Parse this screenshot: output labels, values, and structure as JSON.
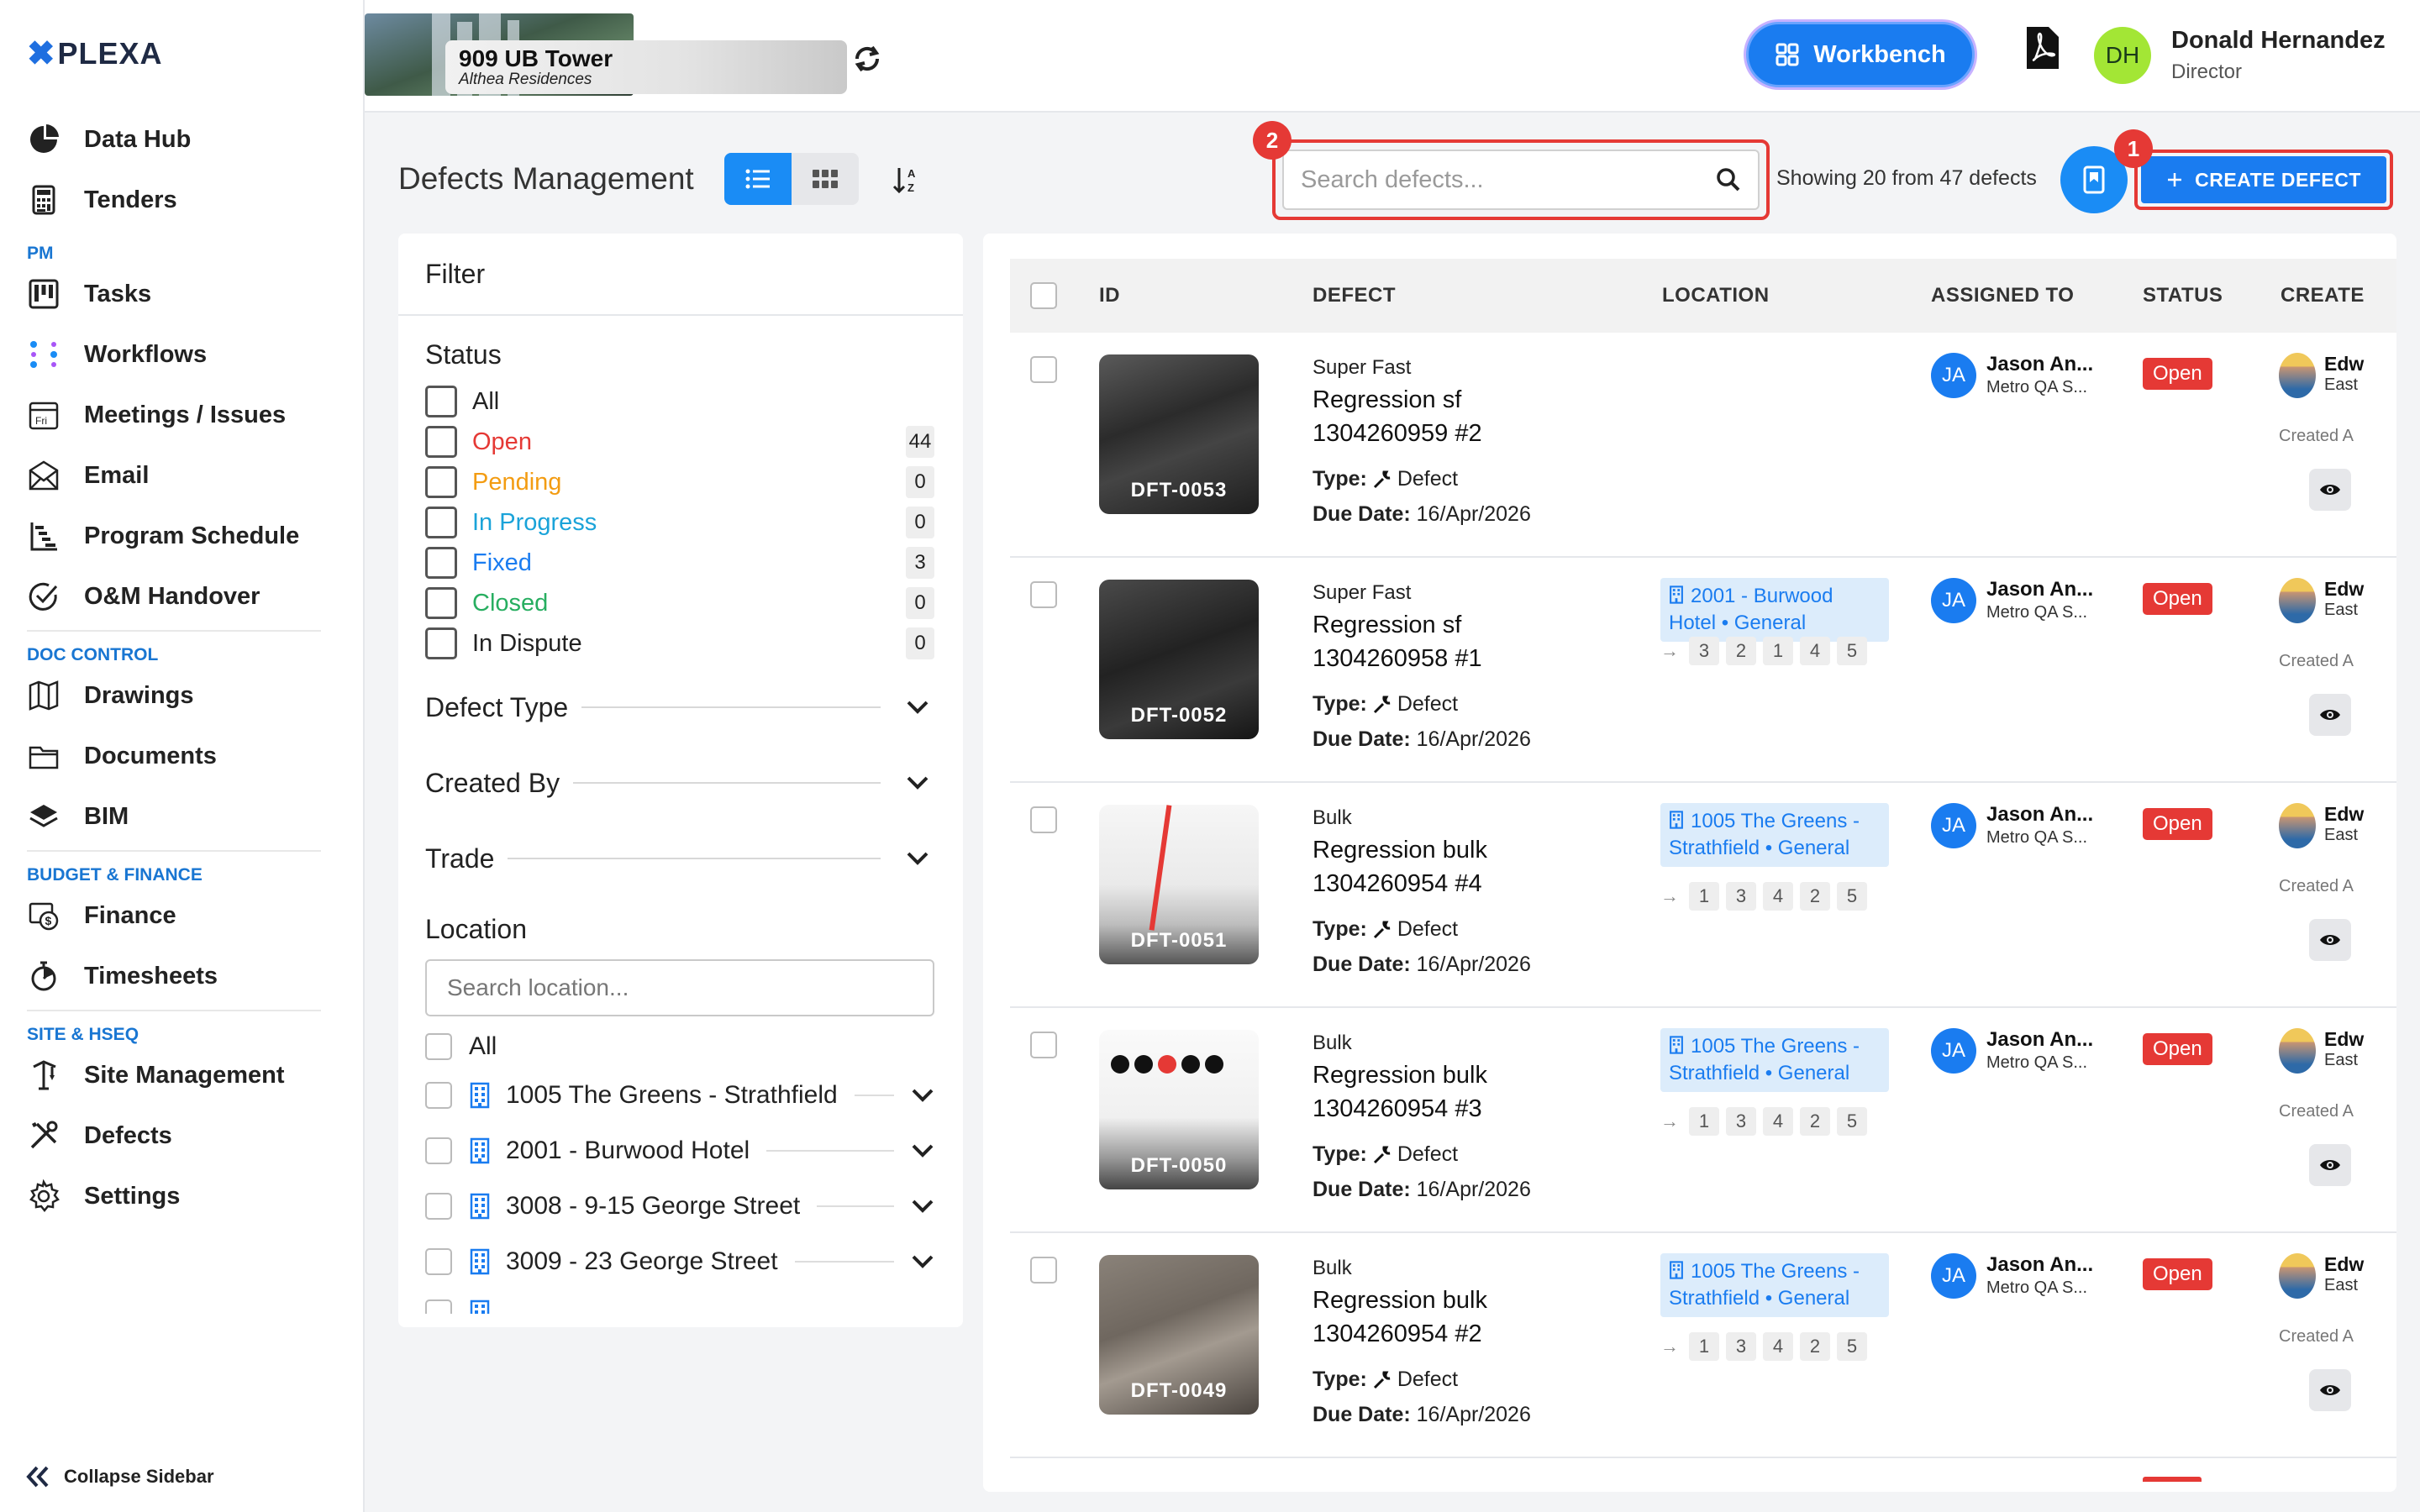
{
  "brand": {
    "logo_mark": "✖",
    "logo_text": "PLEXA"
  },
  "sidebar": {
    "items_top": [
      {
        "label": "Data Hub",
        "icon": "pie-chart-icon"
      },
      {
        "label": "Tenders",
        "icon": "calculator-icon"
      }
    ],
    "sections": [
      {
        "title": "PM",
        "items": [
          {
            "label": "Tasks",
            "icon": "kanban-icon"
          },
          {
            "label": "Workflows",
            "icon": "workflow-icon"
          },
          {
            "label": "Meetings / Issues",
            "icon": "calendar-icon"
          },
          {
            "label": "Email",
            "icon": "envelope-icon"
          },
          {
            "label": "Program Schedule",
            "icon": "gantt-icon"
          },
          {
            "label": "O&M Handover",
            "icon": "check-circle-icon"
          }
        ]
      },
      {
        "title": "DOC CONTROL",
        "items": [
          {
            "label": "Drawings",
            "icon": "map-icon"
          },
          {
            "label": "Documents",
            "icon": "folder-icon"
          },
          {
            "label": "BIM",
            "icon": "layers-icon"
          }
        ]
      },
      {
        "title": "BUDGET & FINANCE",
        "items": [
          {
            "label": "Finance",
            "icon": "finance-icon"
          },
          {
            "label": "Timesheets",
            "icon": "stopwatch-icon"
          }
        ]
      },
      {
        "title": "SITE & HSEQ",
        "items": [
          {
            "label": "Site Management",
            "icon": "crane-icon"
          },
          {
            "label": "Defects",
            "icon": "tools-icon"
          },
          {
            "label": "Settings",
            "icon": "gear-icon"
          }
        ]
      }
    ],
    "collapse_label": "Collapse Sidebar"
  },
  "topbar": {
    "project_name": "909 UB Tower",
    "project_sub": "Althea Residences",
    "workbench_label": "Workbench",
    "user_initials": "DH",
    "user_name": "Donald Hernandez",
    "user_role": "Director"
  },
  "toolbar": {
    "title": "Defects Management",
    "search_placeholder": "Search defects...",
    "showing": "Showing 20 from 47 defects",
    "create_label": "CREATE DEFECT",
    "badge_create": "1",
    "badge_search": "2"
  },
  "filter": {
    "title": "Filter",
    "status_title": "Status",
    "statuses": [
      {
        "label": "All",
        "color": "#222222",
        "count": ""
      },
      {
        "label": "Open",
        "color": "#e53935",
        "count": "44"
      },
      {
        "label": "Pending",
        "color": "#f39c12",
        "count": "0"
      },
      {
        "label": "In Progress",
        "color": "#1aa3d9",
        "count": "0"
      },
      {
        "label": "Fixed",
        "color": "#1a7cf0",
        "count": "3"
      },
      {
        "label": "Closed",
        "color": "#27ae60",
        "count": "0"
      },
      {
        "label": "In Dispute",
        "color": "#222222",
        "count": "0"
      }
    ],
    "accordions": [
      "Defect Type",
      "Created By",
      "Trade"
    ],
    "location_title": "Location",
    "location_placeholder": "Search location...",
    "location_all": "All",
    "locations": [
      "1005 The Greens - Strathfield",
      "2001 - Burwood Hotel",
      "3008 - 9-15 George Street",
      "3009 - 23 George Street"
    ]
  },
  "table": {
    "headers": [
      "ID",
      "DEFECT",
      "LOCATION",
      "ASSIGNED TO",
      "STATUS",
      "CREATE"
    ],
    "type_label": "Type:",
    "due_label": "Due Date:",
    "rows": [
      {
        "id": "DFT-0053",
        "category": "Super Fast",
        "name": "Regression sf 1304260959 #2",
        "type": "Defect",
        "due": "16/Apr/2026",
        "location": "",
        "path": [],
        "assignee": "Jason An...",
        "assignee_org": "Metro QA S...",
        "initials": "JA",
        "status": "Open",
        "creator": "Edw",
        "creator_sub": "East",
        "created": "Created A"
      },
      {
        "id": "DFT-0052",
        "category": "Super Fast",
        "name": "Regression sf 1304260958 #1",
        "type": "Defect",
        "due": "16/Apr/2026",
        "location": "2001 - Burwood Hotel • General",
        "path": [
          "3",
          "2",
          "1",
          "4",
          "5"
        ],
        "assignee": "Jason An...",
        "assignee_org": "Metro QA S...",
        "initials": "JA",
        "status": "Open",
        "creator": "Edw",
        "creator_sub": "East",
        "created": "Created A"
      },
      {
        "id": "DFT-0051",
        "category": "Bulk",
        "name": "Regression bulk 1304260954 #4",
        "type": "Defect",
        "due": "16/Apr/2026",
        "location": "1005 The Greens - Strathfield • General",
        "path": [
          "1",
          "3",
          "4",
          "2",
          "5"
        ],
        "assignee": "Jason An...",
        "assignee_org": "Metro QA S...",
        "initials": "JA",
        "status": "Open",
        "creator": "Edw",
        "creator_sub": "East",
        "created": "Created A"
      },
      {
        "id": "DFT-0050",
        "category": "Bulk",
        "name": "Regression bulk 1304260954 #3",
        "type": "Defect",
        "due": "16/Apr/2026",
        "location": "1005 The Greens - Strathfield • General",
        "path": [
          "1",
          "3",
          "4",
          "2",
          "5"
        ],
        "assignee": "Jason An...",
        "assignee_org": "Metro QA S...",
        "initials": "JA",
        "status": "Open",
        "creator": "Edw",
        "creator_sub": "East",
        "created": "Created A"
      },
      {
        "id": "DFT-0049",
        "category": "Bulk",
        "name": "Regression bulk 1304260954 #2",
        "type": "Defect",
        "due": "16/Apr/2026",
        "location": "1005 The Greens - Strathfield • General",
        "path": [
          "1",
          "3",
          "4",
          "2",
          "5"
        ],
        "assignee": "Jason An...",
        "assignee_org": "Metro QA S...",
        "initials": "JA",
        "status": "Open",
        "creator": "Edw",
        "creator_sub": "East",
        "created": "Created A"
      }
    ]
  }
}
